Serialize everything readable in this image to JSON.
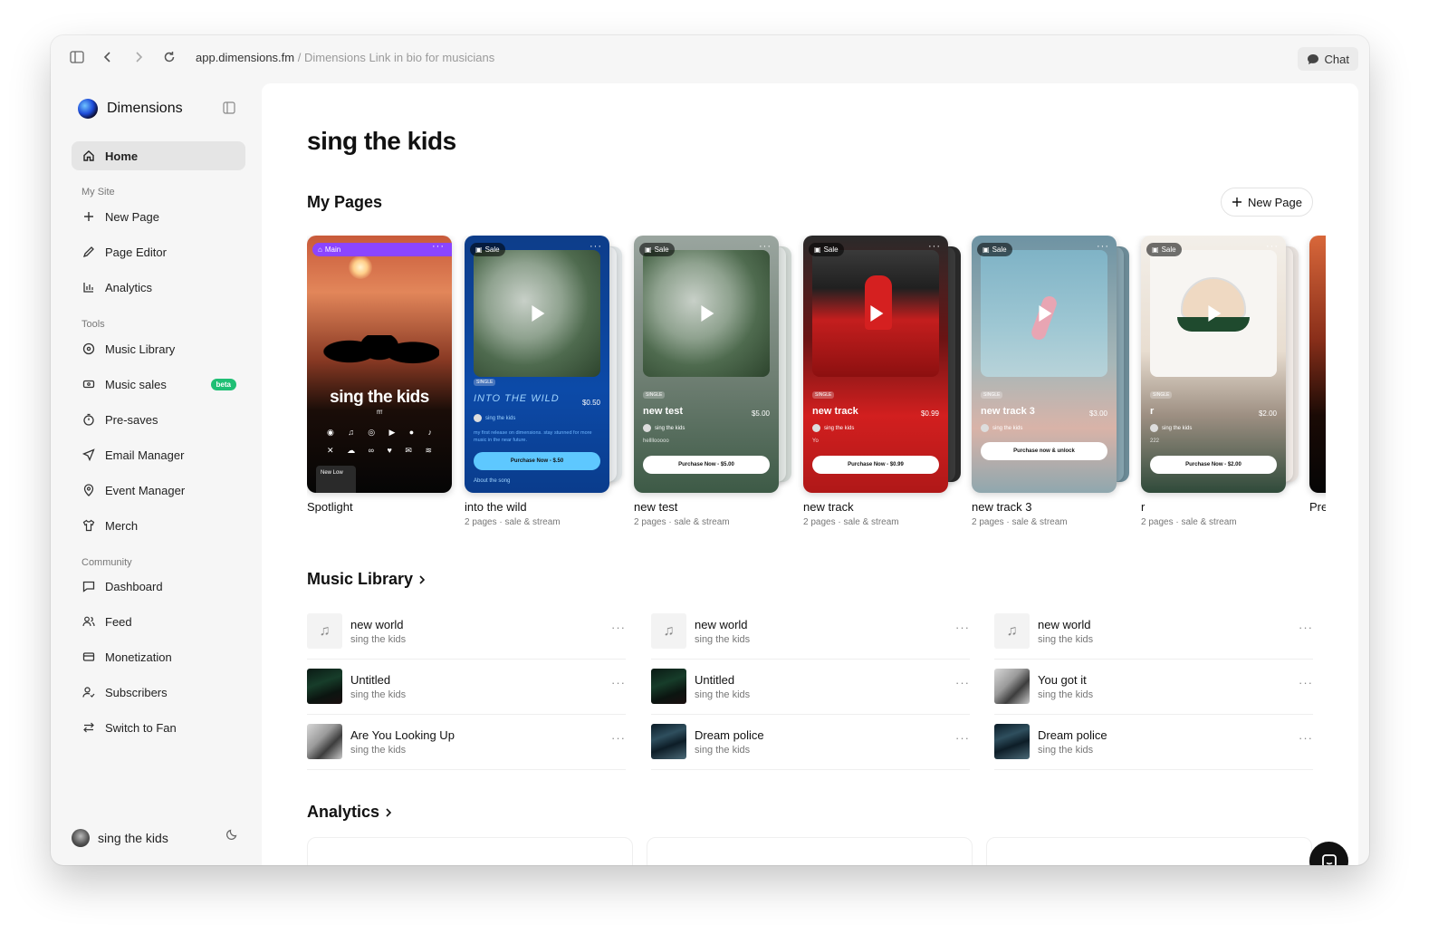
{
  "browser": {
    "url_host": "app.dimensions.fm",
    "url_path": " / Dimensions Link in bio for musicians",
    "chat_label": "Chat"
  },
  "sidebar": {
    "brand": "Dimensions",
    "home": "Home",
    "sections": {
      "my_site": "My Site",
      "tools": "Tools",
      "community": "Community"
    },
    "my_site_items": [
      "New Page",
      "Page Editor",
      "Analytics"
    ],
    "tools_items": [
      "Music Library",
      "Music sales",
      "Pre-saves",
      "Email Manager",
      "Event Manager",
      "Merch"
    ],
    "beta_label": "beta",
    "community_items": [
      "Dashboard",
      "Feed",
      "Monetization",
      "Subscribers",
      "Switch to Fan"
    ],
    "profile_name": "sing the kids"
  },
  "main": {
    "title": "sing the kids",
    "my_pages_title": "My Pages",
    "new_page_label": "New Page",
    "pages": [
      {
        "title": "Spotlight",
        "meta": "",
        "badge": "Main",
        "overlay_name": "sing the kids",
        "overlay_sub": "ffff",
        "new_low": "New Low"
      },
      {
        "title": "into the wild",
        "meta": "2 pages · sale & stream",
        "badge": "Sale",
        "single": "SINGLE",
        "name": "INTO THE WILD",
        "price": "$0.50",
        "artist": "sing the kids",
        "desc": "my first release on dimensions. stay stunned for more music in the near future.",
        "button": "Purchase Now - $.50",
        "about": "About the song"
      },
      {
        "title": "new test",
        "meta": "2 pages · sale & stream",
        "badge": "Sale",
        "single": "SINGLE",
        "name": "new test",
        "price": "$5.00",
        "artist": "sing the kids",
        "desc": "hellllooooo",
        "button": "Purchase Now - $5.00"
      },
      {
        "title": "new track",
        "meta": "2 pages · sale & stream",
        "badge": "Sale",
        "single": "SINGLE",
        "name": "new track",
        "price": "$0.99",
        "artist": "sing the kids",
        "desc": "Yo",
        "button": "Purchase Now - $0.99"
      },
      {
        "title": "new track 3",
        "meta": "2 pages · sale & stream",
        "badge": "Sale",
        "single": "SINGLE",
        "name": "new track 3",
        "price": "$3.00",
        "artist": "sing the kids",
        "desc": "",
        "button": "Purchase now & unlock"
      },
      {
        "title": "r",
        "meta": "2 pages · sale & stream",
        "badge": "Sale",
        "single": "SINGLE",
        "name": "r",
        "price": "$2.00",
        "artist": "sing the kids",
        "desc": "222",
        "button": "Purchase Now - $2.00"
      },
      {
        "title": "Pre",
        "meta": ""
      }
    ],
    "music_library_title": "Music Library",
    "library": [
      [
        {
          "title": "new world",
          "artist": "sing the kids",
          "thumb": "note"
        },
        {
          "title": "Untitled",
          "artist": "sing the kids",
          "thumb": "dark"
        },
        {
          "title": "Are You Looking Up",
          "artist": "sing the kids",
          "thumb": "bw"
        }
      ],
      [
        {
          "title": "new world",
          "artist": "sing the kids",
          "thumb": "note"
        },
        {
          "title": "Untitled",
          "artist": "sing the kids",
          "thumb": "dark"
        },
        {
          "title": "Dream police",
          "artist": "sing the kids",
          "thumb": "police"
        }
      ],
      [
        {
          "title": "new world",
          "artist": "sing the kids",
          "thumb": "note"
        },
        {
          "title": "You got it",
          "artist": "sing the kids",
          "thumb": "bw"
        },
        {
          "title": "Dream police",
          "artist": "sing the kids",
          "thumb": "police"
        }
      ]
    ],
    "analytics_title": "Analytics"
  }
}
